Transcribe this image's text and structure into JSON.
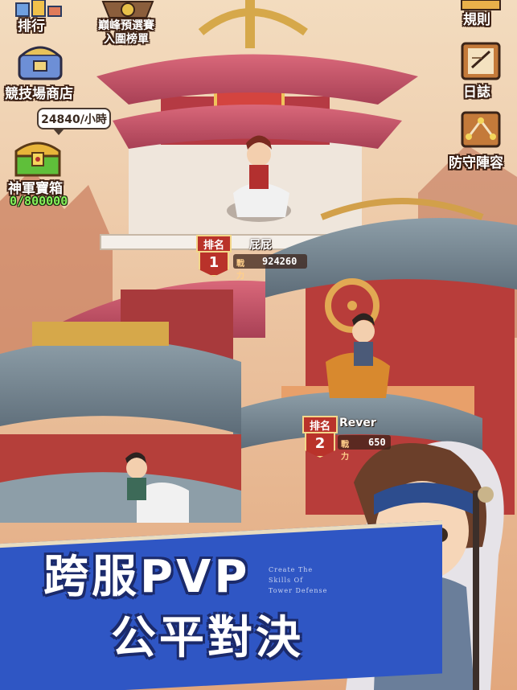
{
  "hud_left": {
    "ranking_label": "排行",
    "pvp_shop_label": "競技場商店",
    "chest_rate": "24840/小時",
    "chest_label": "神軍寶箱",
    "chest_progress": "0/800000"
  },
  "hud_top": {
    "event_label_line1": "巔峰預選賽",
    "event_label_line2": "入圍榜單"
  },
  "hud_right": {
    "rules_label": "規則",
    "log_label": "日誌",
    "defense_label": "防守陣容"
  },
  "ranks": [
    {
      "title": "排名",
      "number": "1",
      "name": "屁屁",
      "power_label": "戰力",
      "power": "924260"
    },
    {
      "title": "排名",
      "number": "2",
      "name": "Rever",
      "power_label": "戰力",
      "power": "650"
    }
  ],
  "promo": {
    "headline_line1": "跨服PVP",
    "headline_line2": "公平對決",
    "mini_line1": "Create The",
    "mini_line2": "Skills Of",
    "mini_line3": "Tower Defense"
  },
  "colors": {
    "banner": "#2f56c4",
    "rank_red": "#b9322a",
    "chest_green": "#86f25a"
  }
}
